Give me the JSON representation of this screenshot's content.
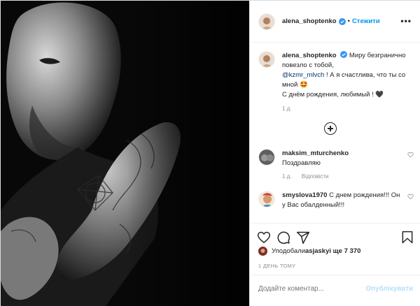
{
  "post": {
    "author": "alena_shoptenko",
    "dot": "•",
    "follow_label": "Стежити",
    "more_label": "•••",
    "caption_lines": [
      "Миру безгранично повезло с тобой,"
    ],
    "caption_start": "Миру безгранично повезло с тобой,",
    "caption_mention": "@kzmr_mlvch",
    "caption_rest": "! А я счастлива, что ты со мной 🤩",
    "caption_end": "С днём рождения, любимый ! 🖤",
    "caption_time": "1 д."
  },
  "comments": [
    {
      "user": "maksim_mturchenko",
      "text": "Поздравляю",
      "time": "1 д.",
      "reply": "Відповісти"
    },
    {
      "user": "smyslova1970",
      "text": "С днем рождения!!! Он у Вас обалденный!!!",
      "time": "",
      "reply": ""
    }
  ],
  "likes": {
    "prefix": "Уподобали ",
    "user": "asjasky",
    "suffix": " і ще 7 370"
  },
  "date": "1 ДЕНЬ ТОМУ",
  "add_comment": {
    "placeholder": "Додайте коментар...",
    "post_label": "Опублікувати"
  },
  "colors": {
    "link": "#0095f6",
    "mention": "#00376b",
    "muted": "#8e8e8e",
    "border": "#efefef",
    "post_disabled": "#b3dffc"
  },
  "icons": [
    "heart-icon",
    "comment-icon",
    "share-icon",
    "bookmark-icon",
    "add-comments-icon",
    "verified-icon"
  ]
}
